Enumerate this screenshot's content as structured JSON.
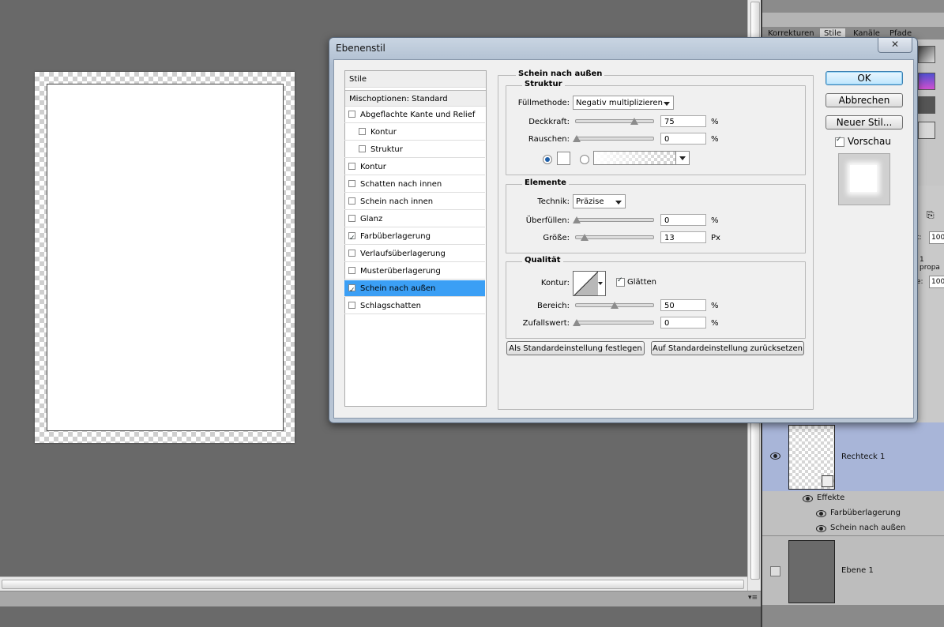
{
  "dialog": {
    "title": "Ebenenstil",
    "close_glyph": "✕",
    "styles_header": "Stile",
    "blend_options": "Mischoptionen: Standard",
    "style_items": [
      {
        "label": "Abgeflachte Kante und Relief",
        "checked": false
      },
      {
        "label": "Kontur",
        "checked": false
      },
      {
        "label": "Struktur",
        "checked": false
      },
      {
        "label": "Kontur",
        "checked": false
      },
      {
        "label": "Schatten nach innen",
        "checked": false
      },
      {
        "label": "Schein nach innen",
        "checked": false
      },
      {
        "label": "Glanz",
        "checked": false
      },
      {
        "label": "Farbüberlagerung",
        "checked": true
      },
      {
        "label": "Verlaufsüberlagerung",
        "checked": false
      },
      {
        "label": "Musterüberlagerung",
        "checked": false
      },
      {
        "label": "Schein nach außen",
        "checked": true,
        "selected": true
      },
      {
        "label": "Schlagschatten",
        "checked": false
      }
    ],
    "section_title": "Schein nach außen",
    "struktur": {
      "title": "Struktur",
      "blend_mode_label": "Füllmethode:",
      "blend_mode_value": "Negativ multiplizieren",
      "opacity_label": "Deckkraft:",
      "opacity_value": "75",
      "noise_label": "Rauschen:",
      "noise_value": "0",
      "unit_percent": "%",
      "color_mode": "solid"
    },
    "elemente": {
      "title": "Elemente",
      "technique_label": "Technik:",
      "technique_value": "Präzise",
      "spread_label": "Überfüllen:",
      "spread_value": "0",
      "size_label": "Größe:",
      "size_value": "13",
      "unit_percent": "%",
      "unit_px": "Px"
    },
    "qualitaet": {
      "title": "Qualität",
      "contour_label": "Kontur:",
      "antialias_label": "Glätten",
      "antialias_checked": true,
      "range_label": "Bereich:",
      "range_value": "50",
      "jitter_label": "Zufallswert:",
      "jitter_value": "0",
      "unit_percent": "%"
    },
    "make_default_button": "Als Standardeinstellung festlegen",
    "reset_default_button": "Auf Standardeinstellung zurücksetzen",
    "ok_button": "OK",
    "cancel_button": "Abbrechen",
    "new_style_button": "Neuer Stil...",
    "preview_label": "Vorschau",
    "preview_checked": true
  },
  "panel": {
    "tabs": [
      "Korrekturen",
      "Stile",
      "Kanäle",
      "Pfade"
    ],
    "active_tab": "Stile",
    "field_labels": [
      "ft:",
      "1 propa",
      "e:"
    ],
    "field_values": [
      "100",
      "100"
    ],
    "layers": [
      {
        "name": "Rechteck 1"
      },
      {
        "name": "Ebene 1"
      }
    ],
    "effects_label": "Effekte",
    "effects": [
      "Farbüberlagerung",
      "Schein nach außen"
    ]
  },
  "status": {
    "menu_glyph": "▾≡"
  }
}
